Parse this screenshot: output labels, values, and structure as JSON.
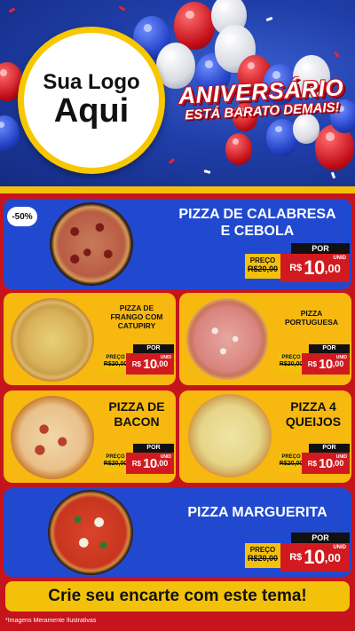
{
  "header": {
    "logo_line1": "Sua Logo",
    "logo_line2": "Aqui",
    "banner_top": "ANIVERSÁRIO",
    "banner_bottom": "ESTÁ BARATO DEMAIS!"
  },
  "colors": {
    "brand_red": "#c5141c",
    "brand_blue": "#2149d0",
    "brand_yellow": "#f4c10a",
    "card_yellow": "#f7b80f"
  },
  "products": {
    "calabresa": {
      "badge": "-50%",
      "name_line1": "PIZZA DE CALABRESA",
      "name_line2": "E CEBOLA",
      "por": "POR",
      "preco_label": "PREÇO",
      "old_price": "R$20,00",
      "currency": "R$",
      "price_int": "10",
      "price_cents": ",00",
      "unit": "UNID"
    },
    "frango": {
      "name_line1": "PIZZA DE",
      "name_line2": "FRANGO COM",
      "name_line3": "CATUPIRY",
      "por": "POR",
      "preco_label": "PREÇO",
      "old_price": "R$20,00",
      "currency": "R$",
      "price_int": "10",
      "price_cents": ",00",
      "unit": "UNID"
    },
    "portuguesa": {
      "name_line1": "PIZZA",
      "name_line2": "PORTUGUESA",
      "por": "POR",
      "preco_label": "PREÇO",
      "old_price": "R$20,00",
      "currency": "R$",
      "price_int": "10",
      "price_cents": ",00",
      "unit": "UNID"
    },
    "bacon": {
      "name_line1": "PIZZA DE",
      "name_line2": "BACON",
      "por": "POR",
      "preco_label": "PREÇO",
      "old_price": "R$20,00",
      "currency": "R$",
      "price_int": "10",
      "price_cents": ",00",
      "unit": "UNID"
    },
    "queijos": {
      "name_line1": "PIZZA 4",
      "name_line2": "QUEIJOS",
      "por": "POR",
      "preco_label": "PREÇO",
      "old_price": "R$20,00",
      "currency": "R$",
      "price_int": "10",
      "price_cents": ",00",
      "unit": "UNID"
    },
    "marguerita": {
      "name_line1": "PIZZA MARGUERITA",
      "por": "POR",
      "preco_label": "PREÇO",
      "old_price": "R$20,00",
      "currency": "R$",
      "price_int": "10",
      "price_cents": ",00",
      "unit": "UNID"
    }
  },
  "cta": {
    "label": "Crie seu encarte com este tema!"
  },
  "footer": {
    "disclaimer": "*Imagens Meramente Ilustrativas"
  }
}
